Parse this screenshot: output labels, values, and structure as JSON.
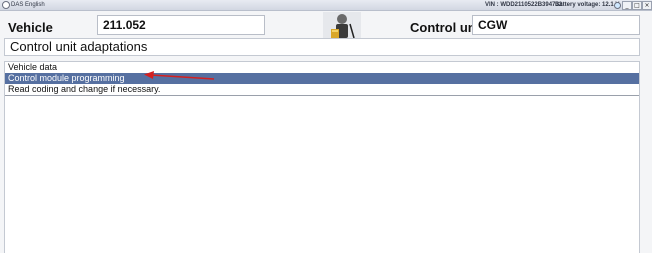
{
  "window": {
    "title": "DAS English",
    "vin": "VIN : WDD2110522B394732",
    "battery": "Battery voltage: 12.1 V",
    "buttons": {
      "minimize": "_",
      "maximize": "□",
      "close": "×"
    }
  },
  "header": {
    "vehicle_label": "Vehicle",
    "vehicle_value": "211.052",
    "control_unit_label": "Control unit",
    "control_unit_value": "CGW"
  },
  "page": {
    "title": "Control unit adaptations"
  },
  "menu": {
    "items": [
      {
        "label": "Vehicle data"
      },
      {
        "label": "Control module programming",
        "selected": true
      },
      {
        "label": "Read coding and change if necessary."
      }
    ]
  },
  "colors": {
    "selection": "#5670a1",
    "annotation_arrow": "#d42020"
  }
}
